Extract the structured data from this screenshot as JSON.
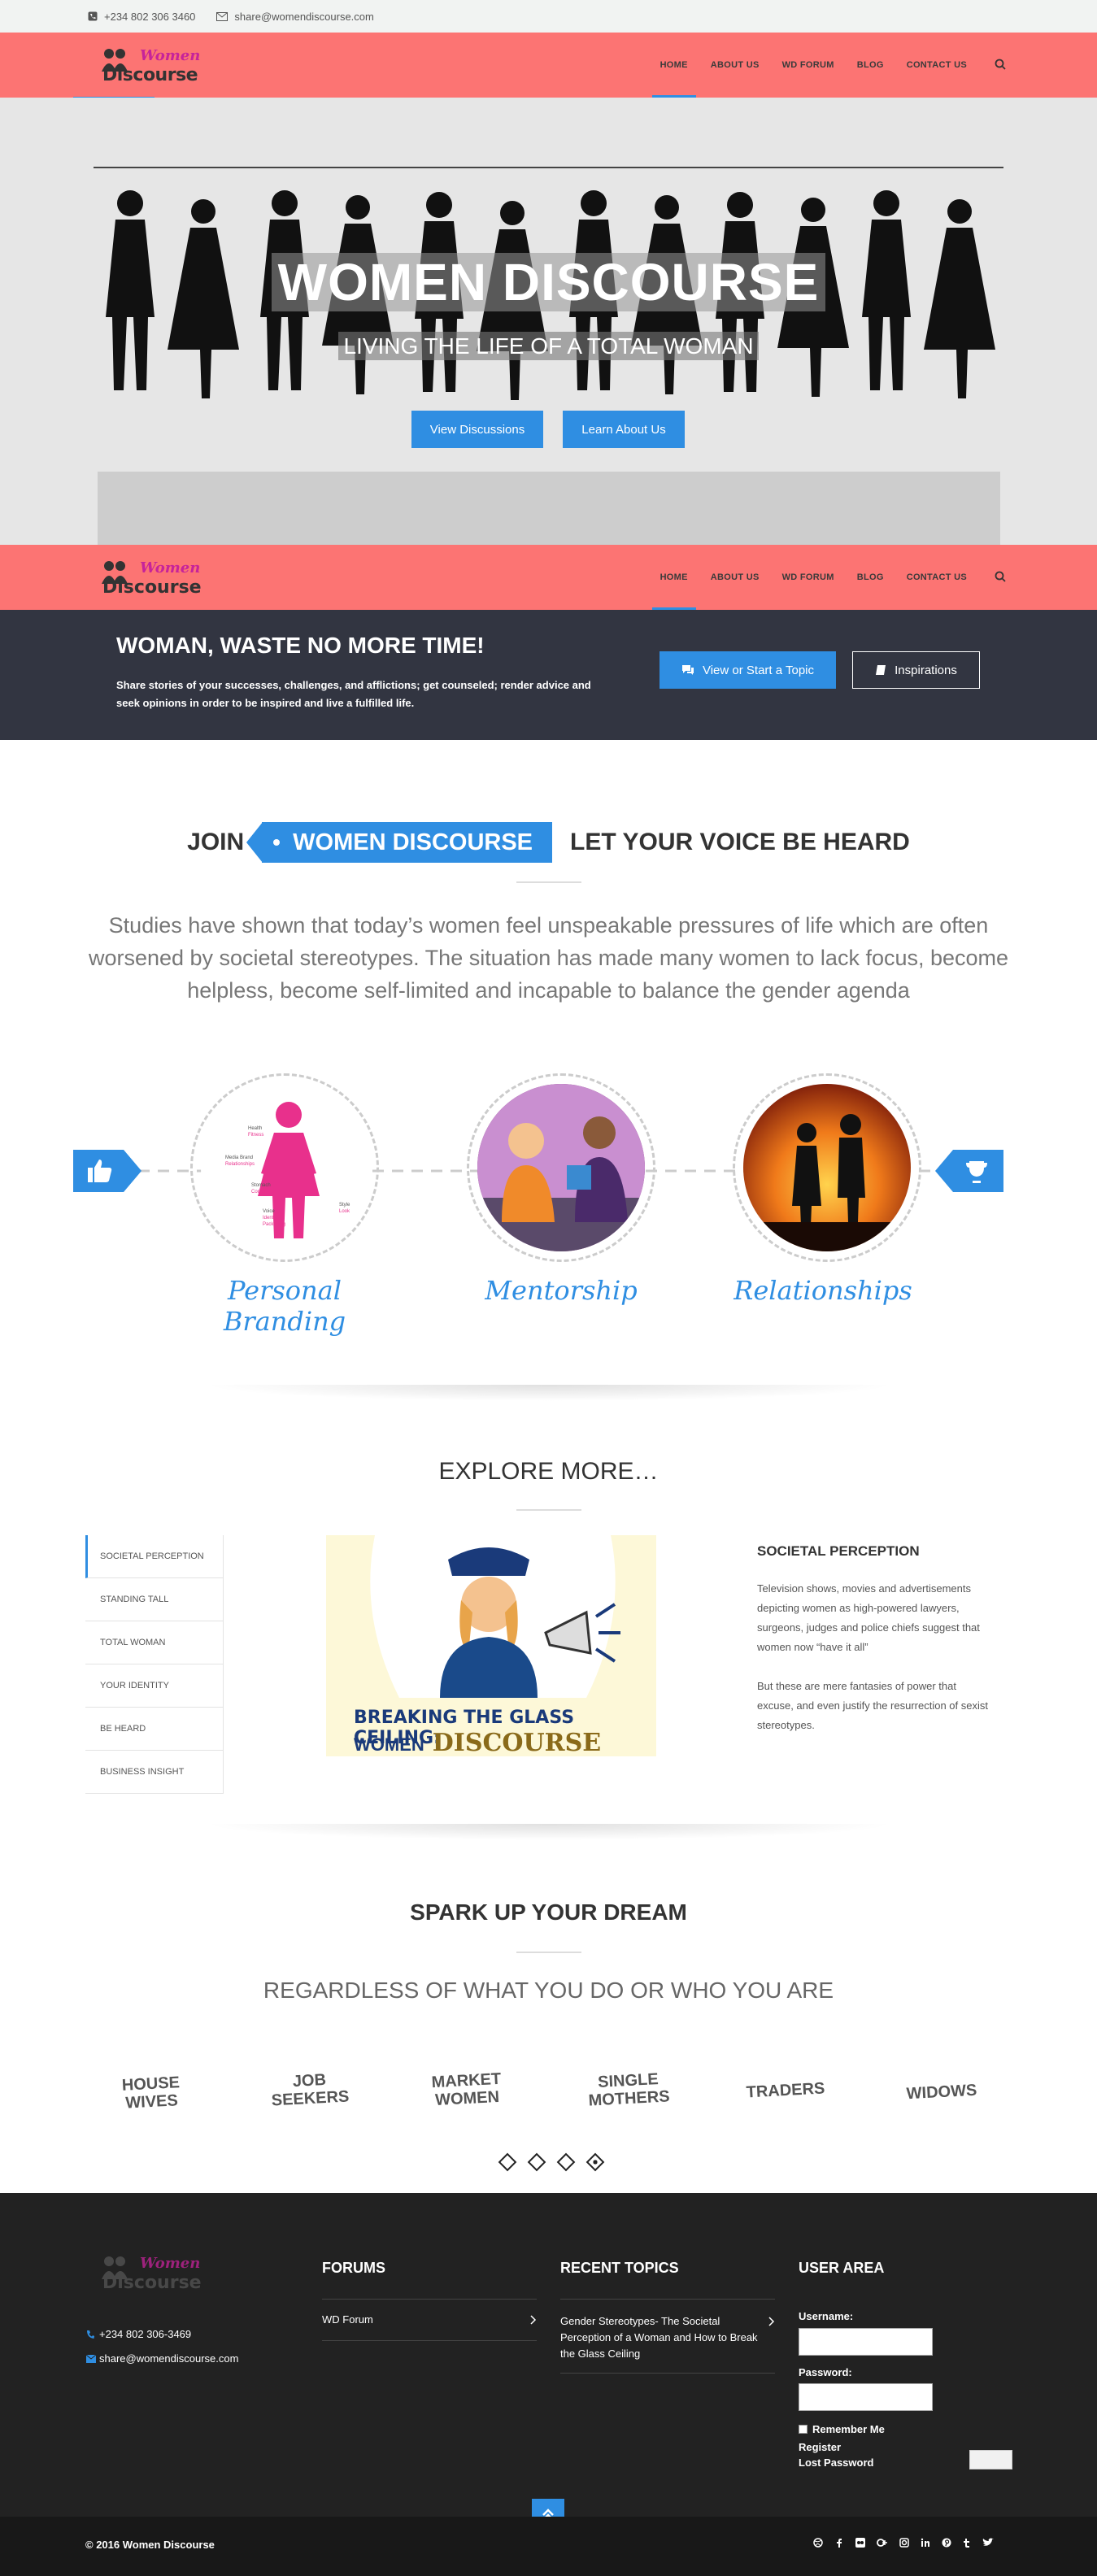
{
  "topbar": {
    "phone": "+234 802 306 3460",
    "email": "share@womendiscourse.com"
  },
  "brand": {
    "line1": "Women",
    "line2": "Discourse",
    "accent": "#fc7473",
    "blue": "#2f8ee2"
  },
  "nav": {
    "items": [
      "HOME",
      "ABOUT US",
      "WD FORUM",
      "BLOG",
      "CONTACT US"
    ]
  },
  "hero": {
    "title": "WOMEN DISCOURSE",
    "subtitle": "LIVING THE LIFE OF A TOTAL WOMAN",
    "btn_primary": "View Discussions",
    "btn_secondary": "Learn About Us"
  },
  "cta": {
    "title": "WOMAN, WASTE NO MORE TIME!",
    "text": "Share stories of your successes, challenges, and afflictions; get counseled; render advice and seek opinions in order to be inspired and live a fulfilled life.",
    "btn_topic": "View or Start a Topic",
    "btn_inspirations": "Inspirations"
  },
  "join": {
    "left": "JOIN",
    "badge": "WOMEN DISCOURSE",
    "right": "LET YOUR VOICE BE HEARD",
    "paragraph": "Studies have shown that today’s women feel unspeakable pressures of life which are often worsened by societal stereotypes. The situation has made many women to lack focus, become helpless, become self-limited and incapable to balance the gender agenda"
  },
  "features": {
    "items": [
      "Personal Branding",
      "Mentorship",
      "Relationships"
    ],
    "figure_labels": [
      "Health",
      "Fitness",
      "Media Brand",
      "Relationships",
      "Stomach",
      "Content",
      "Voice",
      "Identity",
      "Packaging",
      "Style",
      "Look"
    ]
  },
  "explore": {
    "title": "EXPLORE MORE…",
    "tabs": [
      "SOCIETAL PERCEPTION",
      "STANDING TALL",
      "TOTAL WOMAN",
      "YOUR IDENTITY",
      "BE HEARD",
      "BUSINESS INSIGHT"
    ],
    "image_caption_line1": "BREAKING THE GLASS CEILING:",
    "image_caption_women": "WOMEN",
    "image_caption_discourse": "DISCOURSE",
    "panel_title": "SOCIETAL PERCEPTION",
    "panel_p1": "Television shows, movies and advertisements depicting women as high-powered lawyers, surgeons, judges and police chiefs suggest that women now “have it all”",
    "panel_p2": "But these are mere fantasies of power that excuse, and even justify the resurrection of sexist stereotypes."
  },
  "dream": {
    "title": "SPARK UP YOUR DREAM",
    "subtitle": "REGARDLESS OF WHAT YOU DO OR WHO YOU ARE",
    "items": [
      {
        "l1": "HOUSE",
        "l2": "WIVES"
      },
      {
        "l1": "JOB",
        "l2": "SEEKERS"
      },
      {
        "l1": "MARKET",
        "l2": "WOMEN"
      },
      {
        "l1": "SINGLE",
        "l2": "MOTHERS"
      },
      {
        "l1": "TRADERS",
        "l2": ""
      },
      {
        "l1": "WIDOWS",
        "l2": ""
      }
    ]
  },
  "footer": {
    "phone": "+234 802 306-3469",
    "email": "share@womendiscourse.com",
    "forums_title": "FORUMS",
    "forum_link": "WD Forum",
    "recent_title": "RECENT TOPICS",
    "recent_link": "Gender Stereotypes- The Societal Perception of a Woman and How to Break the Glass Ceiling",
    "user_title": "USER AREA",
    "username_label": "Username:",
    "password_label": "Password:",
    "remember": "Remember Me",
    "register": "Register",
    "lost_password": "Lost Password",
    "copyright": "© 2016 Women Discourse"
  }
}
